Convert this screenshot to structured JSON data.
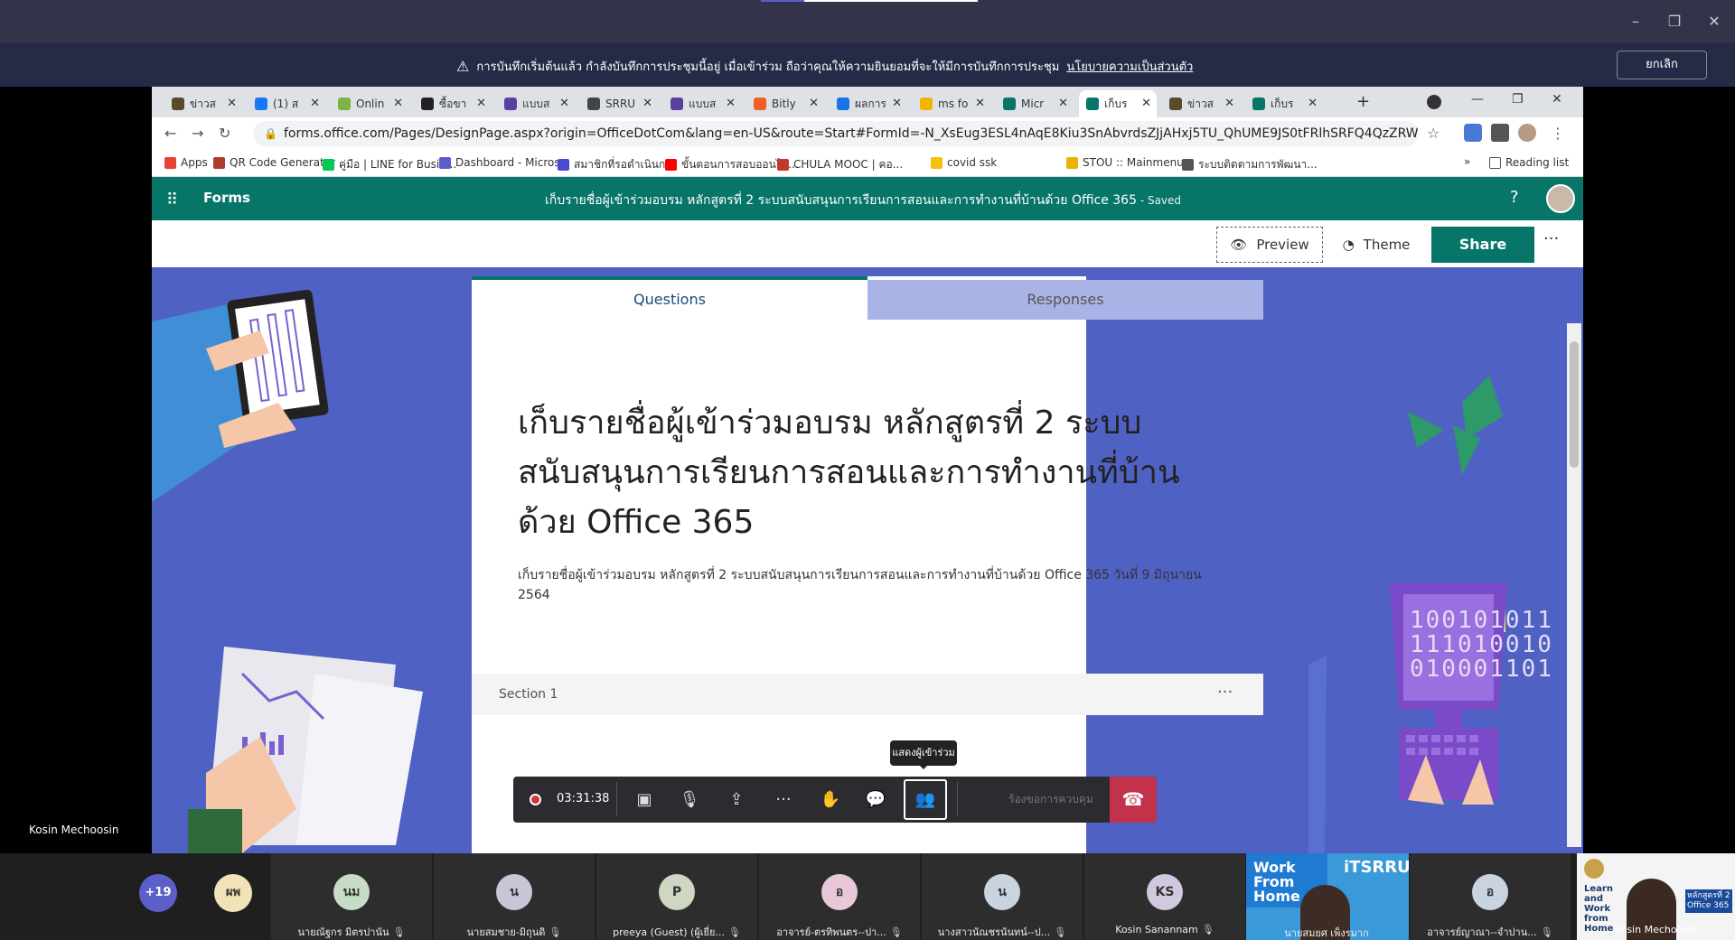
{
  "recording_banner": {
    "message": "การบันทึกเริ่มต้นแล้ว กำลังบันทึกการประชุมนี้อยู่ เมื่อเข้าร่วม ถือว่าคุณให้ความยินยอมที่จะให้มีการบันทึกการประชุม",
    "policy_link": "นโยบายความเป็นส่วนตัว",
    "cancel_label": "ยกเลิก"
  },
  "browser": {
    "tabs": [
      {
        "label": "ข่าวส",
        "color": "#5a4a2a"
      },
      {
        "label": "(1) ส",
        "color": "#1877f2"
      },
      {
        "label": "Onlin",
        "color": "#7cb342"
      },
      {
        "label": "ซื้อขา",
        "color": "#222222"
      },
      {
        "label": "แบบส",
        "color": "#5b3fa0"
      },
      {
        "label": "SRRU",
        "color": "#444444"
      },
      {
        "label": "แบบส",
        "color": "#5b3fa0"
      },
      {
        "label": "Bitly",
        "color": "#ee6123"
      },
      {
        "label": "ผลการ",
        "color": "#1a73e8"
      },
      {
        "label": "ms fo",
        "color": "#f2b400"
      },
      {
        "label": "Micr",
        "color": "#077568"
      },
      {
        "label": "เก็บร",
        "color": "#077568"
      },
      {
        "label": "ข่าวส",
        "color": "#5a4a2a"
      },
      {
        "label": "เก็บร",
        "color": "#077568"
      }
    ],
    "url": "forms.office.com/Pages/DesignPage.aspx?origin=OfficeDotCom&lang=en-US&route=Start#FormId=-N_XsEug3ESL4nAqE8Kiu3SnAbvrdsZJjAHxj5TU_QhUME9JS0tFRlhSRFQ4QzZRWUJUQ1o3NDR...",
    "bookmarks": [
      {
        "label": "Apps",
        "color": "#e94235"
      },
      {
        "label": "QR Code Generator",
        "color": "#b03a2e"
      },
      {
        "label": "คู่มือ | LINE for Busin...",
        "color": "#06c755"
      },
      {
        "label": "Dashboard - Micros...",
        "color": "#5b5fc7"
      },
      {
        "label": "สมาชิกที่รอดำเนินการ",
        "color": "#4a4ad0"
      },
      {
        "label": "ขั้นตอนการสอบออนไล...",
        "color": "#ff0000"
      },
      {
        "label": "CHULA MOOC | คอ...",
        "color": "#c0392b"
      },
      {
        "label": "covid ssk",
        "color": "#f4c20d"
      },
      {
        "label": "STOU :: Mainmenu",
        "color": "#e8b400"
      },
      {
        "label": "ระบบติดตามการพัฒนา...",
        "color": "#555555"
      }
    ],
    "more_bookmarks": "»",
    "reading_list": "Reading list"
  },
  "forms": {
    "app_name": "Forms",
    "doc_title": "เก็บรายชื่อผู้เข้าร่วมอบรม หลักสูตรที่ 2 ระบบสนับสนุนการเรียนการสอนและการทำงานที่บ้านด้วย Office 365",
    "saved_status": " - Saved",
    "help": "?",
    "preview_label": "Preview",
    "theme_label": "Theme",
    "share_label": "Share",
    "more": "···",
    "tab_questions": "Questions",
    "tab_responses": "Responses",
    "title": "เก็บรายชื่อผู้เข้าร่วมอบรม หลักสูตรที่ 2 ระบบสนับสนุนการเรียนการสอนและการทำงานที่บ้านด้วย Office 365",
    "description": "เก็บรายชื่อผู้เข้าร่วมอบรม หลักสูตรที่ 2 ระบบสนับสนุนการเรียนการสอนและการทำงานที่บ้านด้วย Office 365 วันที่ 9 มิถุนายน 2564",
    "section_label": "Section 1",
    "section_more": "···"
  },
  "decor": {
    "binary_lines": [
      "100101011",
      "111010010",
      "010001101"
    ]
  },
  "meeting": {
    "timer": "03:31:38",
    "tooltip": "แสดงผู้เข้าร่วม",
    "control_request": "ร้องขอการควบคุม",
    "presenter_name": "Kosin Mechoosin"
  },
  "participants": {
    "overflow_count": "+19",
    "small_avatar": "ผพ",
    "tiles": [
      {
        "initials": "นม",
        "name": "นายณัฐกร มิตรปานัน",
        "color": "#c7dcc5"
      },
      {
        "initials": "น",
        "name": "นายสมชาย-มิถุนดิ",
        "color": "#c9c5d8"
      },
      {
        "initials": "P",
        "name": "preeya (Guest) (ผู้เยี่ย...",
        "color": "#cfd6c2"
      },
      {
        "initials": "อ",
        "name": "อาจารย์-ตรทิพนตร--ปา...",
        "color": "#e8c8d8"
      },
      {
        "initials": "น",
        "name": "นางสาวนัณชรนันทน์--ป...",
        "color": "#c9d4e0"
      },
      {
        "initials": "KS",
        "name": "Kosin Sanannam",
        "color": "#d1c9e0"
      }
    ],
    "video_name_1": "นายสมยศ เพ็งรมาก",
    "video_tile_1_title": "Work From Home",
    "video_tile_1_brand": "iTSRRU",
    "tile_8_initials": "อ",
    "tile_8_name": "อาจารย์ญาณา--จำปาน...",
    "video_name_2": "Kosin Mechoosin",
    "video_tile_2_text": "Learn and Work from Home",
    "video_tile_2_badge": "หลักสูตรที่ 2 Office 365"
  }
}
